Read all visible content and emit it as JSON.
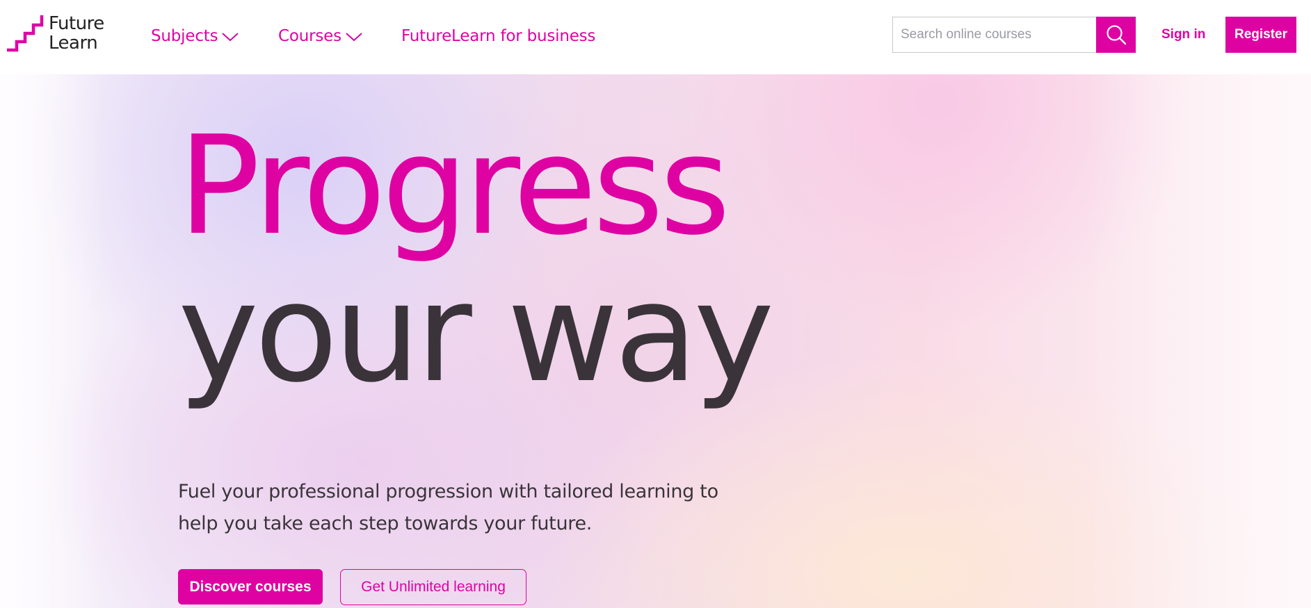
{
  "brand": {
    "name_line1": "Future",
    "name_line2": "Learn",
    "accent_color": "#df02a2",
    "text_color": "#3a343a"
  },
  "header": {
    "nav": [
      {
        "label": "Subjects",
        "icon": "chevron-down-icon",
        "has_dropdown": true
      },
      {
        "label": "Courses",
        "icon": "chevron-down-icon",
        "has_dropdown": true
      },
      {
        "label": "FutureLearn for business",
        "has_dropdown": false
      }
    ],
    "search": {
      "placeholder": "Search online courses",
      "value": "",
      "button_icon": "search-icon"
    },
    "sign_in_label": "Sign in",
    "register_label": "Register"
  },
  "hero": {
    "title_line1": "Progress",
    "title_line2": "your way",
    "subtitle_line1": "Fuel your professional progression with tailored learning to",
    "subtitle_line2": "help you take each step towards your future.",
    "primary_cta": "Discover courses",
    "secondary_cta": "Get Unlimited learning"
  }
}
